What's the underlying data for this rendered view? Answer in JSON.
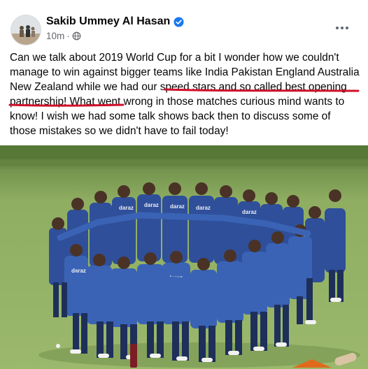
{
  "post": {
    "author_name": "Sakib Ummey Al Hasan",
    "timestamp": "10m",
    "audience_icon": "globe-icon",
    "verified_icon": "verified-badge-icon",
    "more_icon": "more-options-icon",
    "text": "Can we talk about 2019 World Cup for a bit I wonder how we couldn't manage to win against bigger teams like India Pakistan England Australia New Zealand while we had our speed stars and so called best opening partnership! What went wrong in those matches curious mind wants to know! I wish we had some talk shows back then to discuss some of those mistakes so we didn't have to fail today!"
  },
  "photo": {
    "jersey_text": "daraz"
  },
  "colors": {
    "verified_blue": "#1877f2",
    "secondary_text": "#65676b",
    "underline_red": "#d0102a",
    "jersey_blue": "#3a63b5",
    "grass_green": "#8fae62"
  }
}
